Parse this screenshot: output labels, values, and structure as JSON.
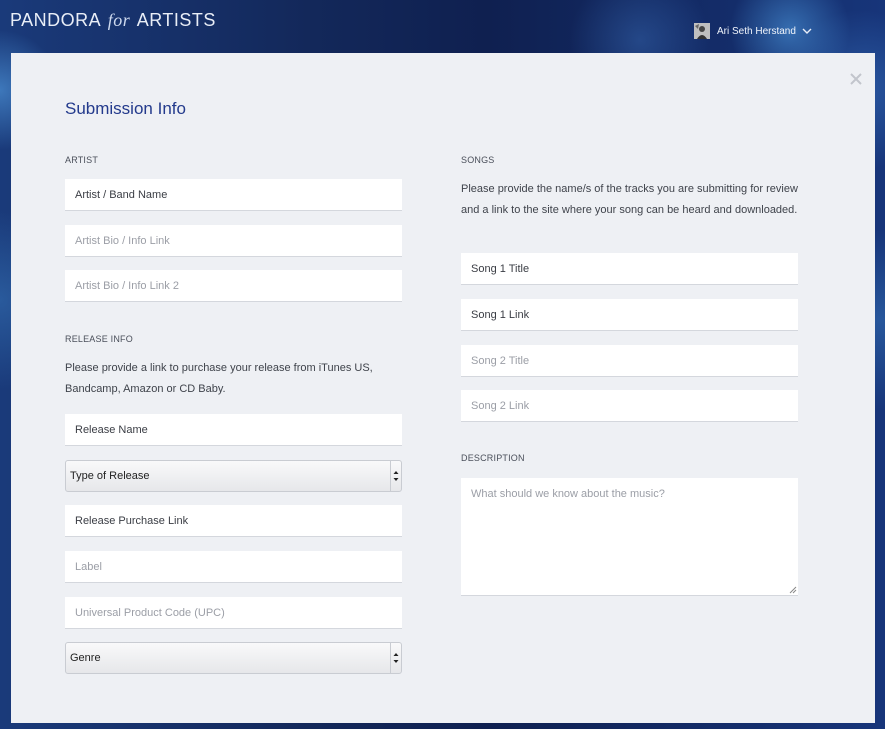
{
  "header": {
    "logo_pandora": "PANDORA",
    "logo_for": "for",
    "logo_artists": "ARTISTS",
    "user_name": "Ari Seth Herstand"
  },
  "form": {
    "title": "Submission Info",
    "artist": {
      "section_label": "ARTIST",
      "band_name_placeholder": "Artist / Band Name",
      "bio_link_placeholder": "Artist Bio / Info Link",
      "bio_link2_placeholder": "Artist Bio / Info Link 2"
    },
    "release": {
      "section_label": "RELEASE INFO",
      "help_line1": "Please provide a link to purchase your release from iTunes US,",
      "help_line2": "Bandcamp, Amazon or CD Baby.",
      "name_placeholder": "Release Name",
      "type_select": "Type of Release",
      "purchase_link_placeholder": "Release Purchase Link",
      "label_placeholder": "Label",
      "upc_placeholder": "Universal Product Code (UPC)",
      "genre_select": "Genre"
    },
    "songs": {
      "section_label": "SONGS",
      "help_line1": "Please provide the name/s of the tracks you are submitting for review",
      "help_line2": "and a link to the site where your song can be heard and downloaded.",
      "song1_title_placeholder": "Song 1 Title",
      "song1_link_placeholder": "Song 1 Link",
      "song2_title_placeholder": "Song 2 Title",
      "song2_link_placeholder": "Song 2 Link"
    },
    "description": {
      "section_label": "DESCRIPTION",
      "placeholder": "What should we know about the music?"
    }
  },
  "colors": {
    "title": "#233a8c",
    "panel_bg": "#eef0f4",
    "header_bg": "#13285a"
  },
  "icons": {
    "close": "close-icon",
    "dropdown": "chevron-down-icon",
    "select_arrows": "select-arrows-icon"
  }
}
